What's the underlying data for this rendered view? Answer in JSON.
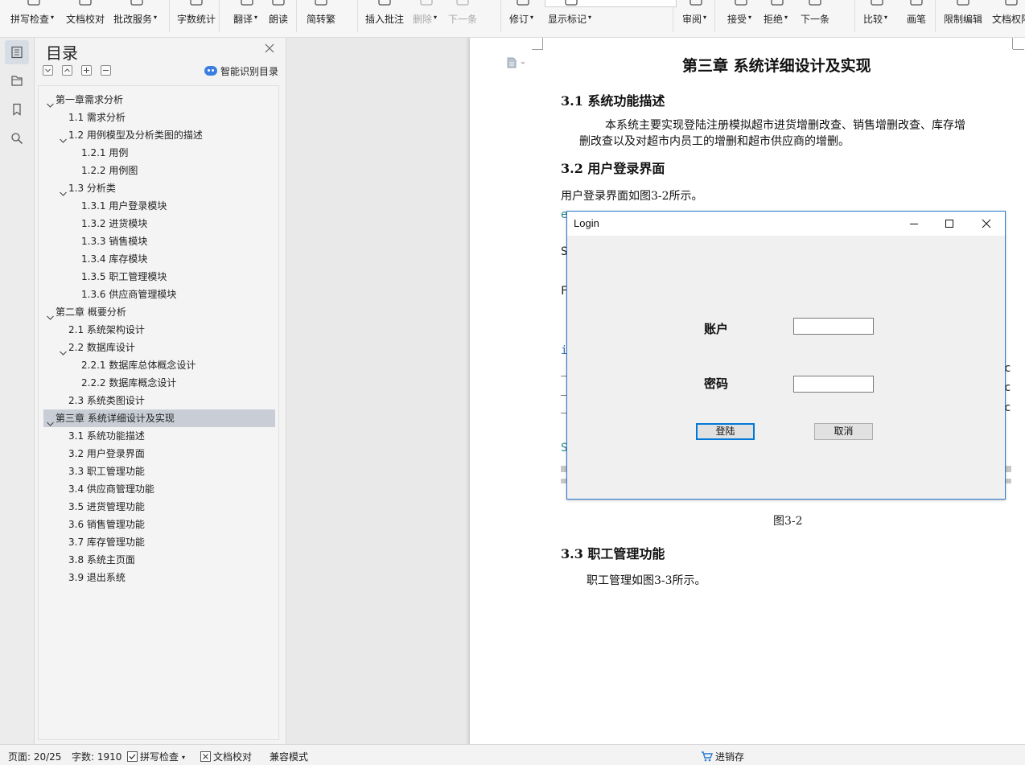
{
  "ribbon": {
    "items": [
      {
        "label": "拼写检查",
        "caret": true,
        "icon": "check-icon"
      },
      {
        "label": "文档校对",
        "caret": false,
        "icon": "doc-check-icon"
      },
      {
        "label": "批改服务",
        "caret": true,
        "icon": "doc-search-icon"
      },
      {
        "label": "字数统计",
        "caret": false,
        "icon": "word-count-icon"
      },
      {
        "label": "翻译",
        "caret": true,
        "icon": "translate-icon"
      },
      {
        "label": "朗读",
        "caret": false,
        "icon": "read-aloud-icon"
      },
      {
        "label": "简转繁",
        "caret": false,
        "icon": "simplified-traditional-icon"
      },
      {
        "label": "插入批注",
        "caret": false,
        "icon": "comment-icon"
      },
      {
        "label": "删除",
        "caret": true,
        "icon": "delete-comment-icon"
      },
      {
        "label": "下一条",
        "caret": false,
        "icon": "next-comment-icon"
      },
      {
        "label": "修订",
        "caret": true,
        "icon": "track-changes-icon"
      },
      {
        "label": "显示标记",
        "caret": true,
        "icon": "show-markup-icon"
      },
      {
        "label": "审阅",
        "caret": true,
        "icon": "review-icon"
      },
      {
        "label": "接受",
        "caret": true,
        "icon": "accept-icon"
      },
      {
        "label": "拒绝",
        "caret": true,
        "icon": "reject-icon"
      },
      {
        "label": "下一条",
        "caret": false,
        "icon": "next-change-icon"
      },
      {
        "label": "比较",
        "caret": true,
        "icon": "compare-icon"
      },
      {
        "label": "画笔",
        "caret": false,
        "icon": "pen-icon"
      },
      {
        "label": "限制编辑",
        "caret": false,
        "icon": "restrict-edit-icon"
      },
      {
        "label": "文档权限",
        "caret": false,
        "icon": "doc-permission-icon"
      }
    ]
  },
  "toc": {
    "title": "目录",
    "smart_label": "智能识别目录",
    "items": [
      {
        "text": "第一章需求分析",
        "level": 0,
        "expanded": true
      },
      {
        "text": "1.1 需求分析",
        "level": 1
      },
      {
        "text": "1.2  用例模型及分析类图的描述",
        "level": 1,
        "expanded": true
      },
      {
        "text": "1.2.1  用例",
        "level": 2
      },
      {
        "text": "1.2.2  用例图",
        "level": 2
      },
      {
        "text": "1.3 分析类",
        "level": 1,
        "expanded": true
      },
      {
        "text": "1.3.1 用户登录模块",
        "level": 2
      },
      {
        "text": "1.3.2 进货模块",
        "level": 2
      },
      {
        "text": "1.3.3 销售模块",
        "level": 2
      },
      {
        "text": "1.3.4 库存模块",
        "level": 2
      },
      {
        "text": "1.3.5 职工管理模块",
        "level": 2
      },
      {
        "text": "1.3.6 供应商管理模块",
        "level": 2
      },
      {
        "text": "第二章  概要分析",
        "level": 0,
        "expanded": true
      },
      {
        "text": "2.1 系统架构设计",
        "level": 1
      },
      {
        "text": "2.2 数据库设计",
        "level": 1,
        "expanded": true
      },
      {
        "text": "2.2.1 数据库总体概念设计",
        "level": 2
      },
      {
        "text": "2.2.2 数据库概念设计",
        "level": 2
      },
      {
        "text": "2.3 系统类图设计",
        "level": 1
      },
      {
        "text": "第三章  系统详细设计及实现",
        "level": 0,
        "expanded": true,
        "selected": true
      },
      {
        "text": "3.1 系统功能描述",
        "level": 1
      },
      {
        "text": "3.2 用户登录界面",
        "level": 1
      },
      {
        "text": "3.3 职工管理功能",
        "level": 1
      },
      {
        "text": "3.4 供应商管理功能",
        "level": 1
      },
      {
        "text": "3.5 进货管理功能",
        "level": 1
      },
      {
        "text": "3.6 销售管理功能",
        "level": 1
      },
      {
        "text": "3.7 库存管理功能",
        "level": 1
      },
      {
        "text": "3.8 系统主页面",
        "level": 1
      },
      {
        "text": "3.9 退出系统",
        "level": 1
      }
    ]
  },
  "document": {
    "chapter_title": "第三章  系统详细设计及实现",
    "s31_heading": "3.1 系统功能描述",
    "s31_body_line1": "本系统主要实现登陆注册模拟超市进货增删改查、销售增删改查、库存增",
    "s31_body_line2": "删改查以及对超市内员工的增删和超市供应商的增删。",
    "s32_heading": "3.2 用户登录界面",
    "s32_body": "用户登录界面如图3-2所示。",
    "figure_caption": "图3-2",
    "s33_heading": "3.3 职工管理功能",
    "s33_body": "职工管理如图3-3所示。",
    "code_fragments": {
      "l1": "e",
      "l2": "S",
      "l3": "F",
      "l4": "i",
      "l5": "S",
      "r1": "c",
      "r2": "c",
      "r3": "c"
    }
  },
  "login_dialog": {
    "title": "Login",
    "account_label": "账户",
    "password_label": "密码",
    "account_value": "",
    "password_value": "",
    "login_button": "登陆",
    "cancel_button": "取消"
  },
  "status": {
    "page": "页面: 20/25",
    "word_count": "字数: 1910",
    "spell_check": "拼写检查",
    "doc_check": "文档校对",
    "compat_mode": "兼容模式",
    "sales_inventory": "进销存"
  },
  "colors": {
    "accent_blue": "#2b79d1",
    "toc_selected": "#c9ced6",
    "code_blue": "#3a6fb0",
    "code_teal": "#2a8a8a"
  }
}
